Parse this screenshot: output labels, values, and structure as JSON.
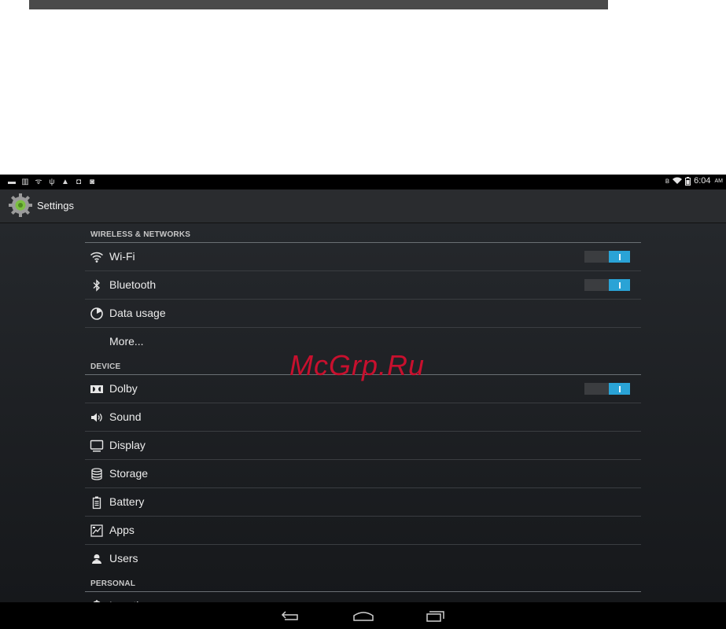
{
  "status_bar": {
    "left_icons": [
      "screen-icon",
      "barcode-icon",
      "wifi-small-icon",
      "usb-icon",
      "warning-icon",
      "download-icon",
      "camera-icon"
    ],
    "right_icons": [
      "bluetooth-icon",
      "wifi-icon",
      "battery-icon"
    ],
    "time": "6:04",
    "ampm": "AM"
  },
  "action_bar": {
    "title": "Settings",
    "icon": "gear-icon"
  },
  "sections": [
    {
      "header": "WIRELESS & NETWORKS",
      "items": [
        {
          "label": "Wi-Fi",
          "icon": "wifi-icon",
          "toggle": true
        },
        {
          "label": "Bluetooth",
          "icon": "bluetooth-icon",
          "toggle": true
        },
        {
          "label": "Data usage",
          "icon": "data-usage-icon"
        },
        {
          "label": "More..."
        }
      ]
    },
    {
      "header": "DEVICE",
      "items": [
        {
          "label": "Dolby",
          "icon": "dolby-icon",
          "toggle": true
        },
        {
          "label": "Sound",
          "icon": "speaker-icon"
        },
        {
          "label": "Display",
          "icon": "display-icon"
        },
        {
          "label": "Storage",
          "icon": "storage-icon"
        },
        {
          "label": "Battery",
          "icon": "battery-icon"
        },
        {
          "label": "Apps",
          "icon": "apps-icon"
        },
        {
          "label": "Users",
          "icon": "user-icon"
        }
      ]
    },
    {
      "header": "PERSONAL",
      "items": [
        {
          "label": "Location",
          "icon": "location-icon"
        }
      ]
    }
  ],
  "nav_bar": {
    "buttons": [
      "back-icon",
      "home-icon",
      "recent-apps-icon"
    ]
  },
  "watermark": "McGrp.Ru",
  "colors": {
    "accent": "#2aa3d6",
    "background": "#1b1e22",
    "watermark": "#c8102e"
  }
}
